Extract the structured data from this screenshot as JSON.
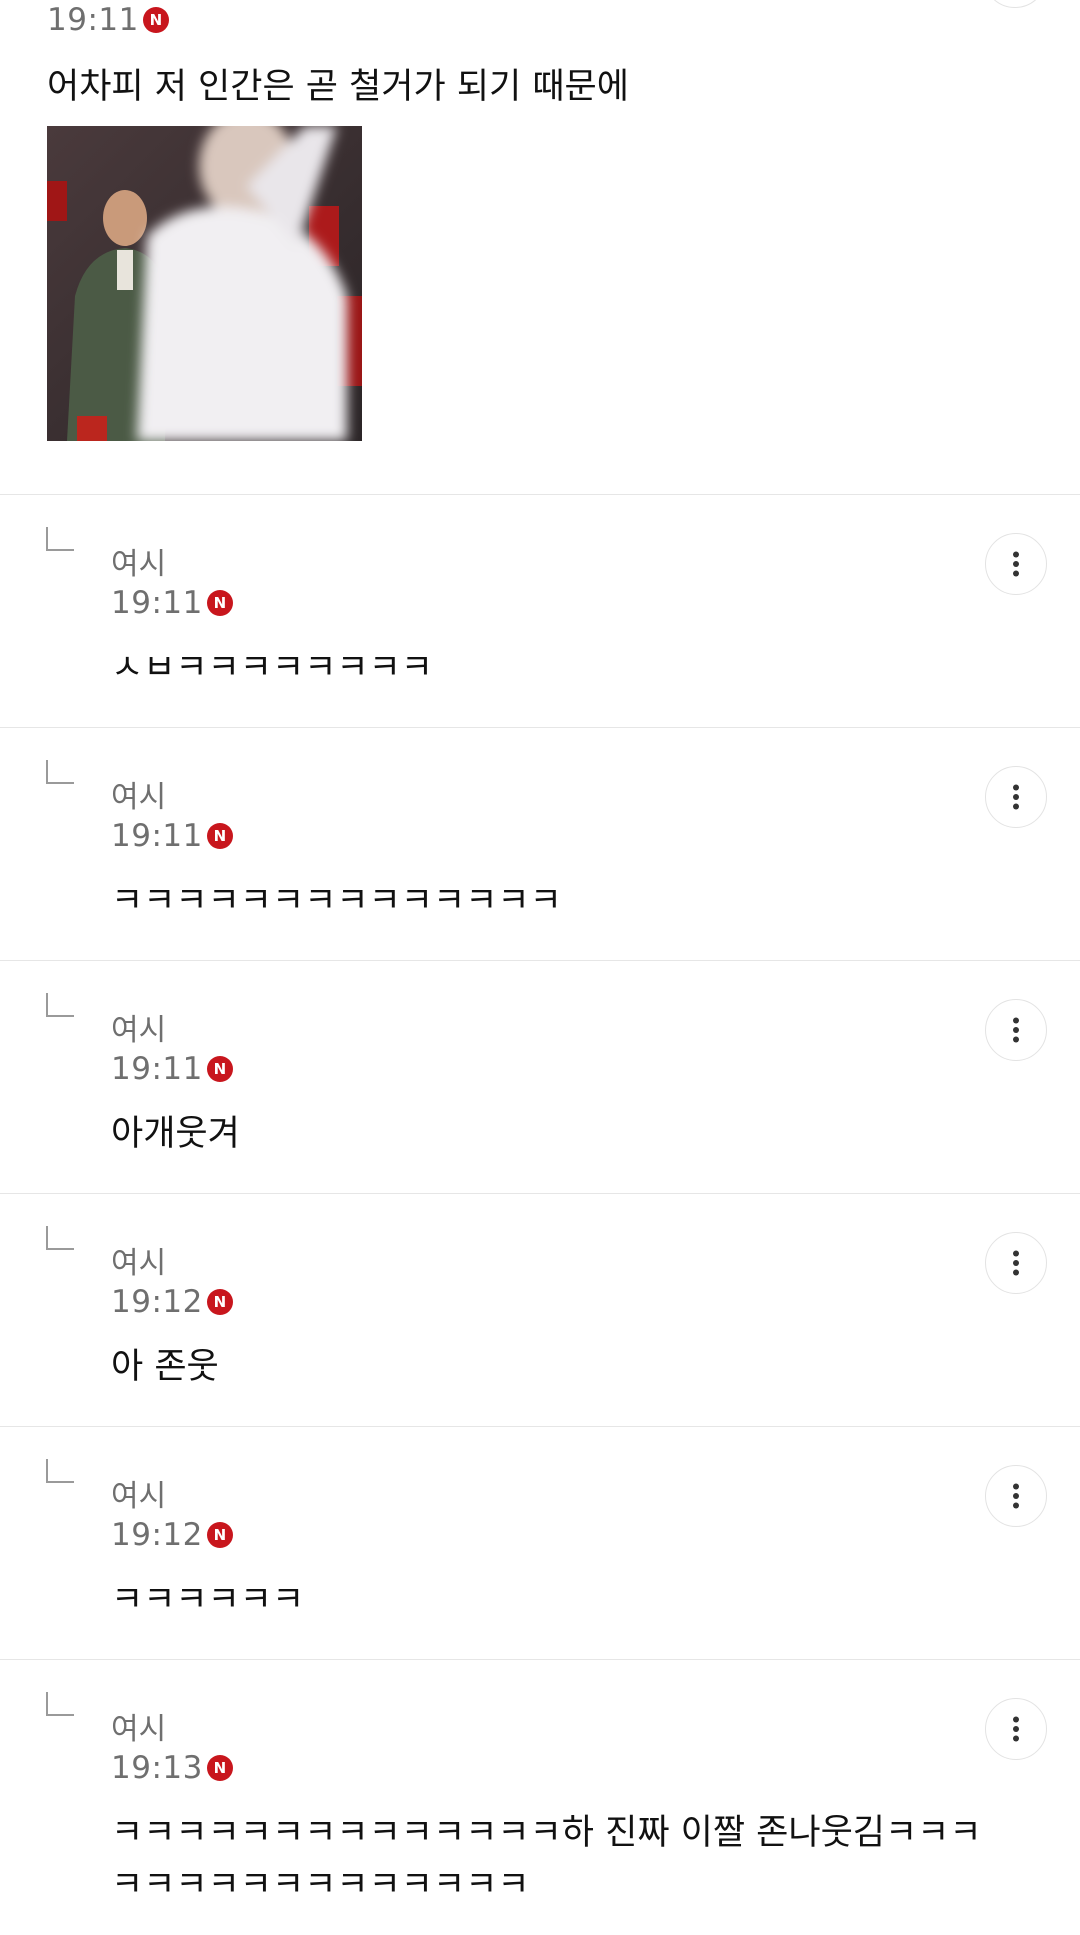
{
  "top_comment": {
    "time": "19:11",
    "new_badge": "N",
    "text": "어차피 저 인간은 곧 철거가 되기 때문에"
  },
  "replies": [
    {
      "author": "여시",
      "time": "19:11",
      "new_badge": "N",
      "text": "ㅅㅂㅋㅋㅋㅋㅋㅋㅋㅋ"
    },
    {
      "author": "여시",
      "time": "19:11",
      "new_badge": "N",
      "text": "ㅋㅋㅋㅋㅋㅋㅋㅋㅋㅋㅋㅋㅋㅋ"
    },
    {
      "author": "여시",
      "time": "19:11",
      "new_badge": "N",
      "text": "아개웃겨"
    },
    {
      "author": "여시",
      "time": "19:12",
      "new_badge": "N",
      "text": "아 존웃"
    },
    {
      "author": "여시",
      "time": "19:12",
      "new_badge": "N",
      "text": "ㅋㅋㅋㅋㅋㅋ"
    },
    {
      "author": "여시",
      "time": "19:13",
      "new_badge": "N",
      "text": "ㅋㅋㅋㅋㅋㅋㅋㅋㅋㅋㅋㅋㅋㅋ하 진짜 이짤 존나웃김ㅋㅋㅋㅋㅋㅋㅋㅋㅋㅋㅋㅋㅋㅋㅋㅋ"
    }
  ],
  "icons": {
    "more": "more-vertical-icon",
    "new": "new-badge-icon",
    "reply": "reply-arrow-icon"
  },
  "colors": {
    "new_badge": "#c8161d",
    "meta_text": "#6f6f6f",
    "divider": "#e6e6e6"
  }
}
